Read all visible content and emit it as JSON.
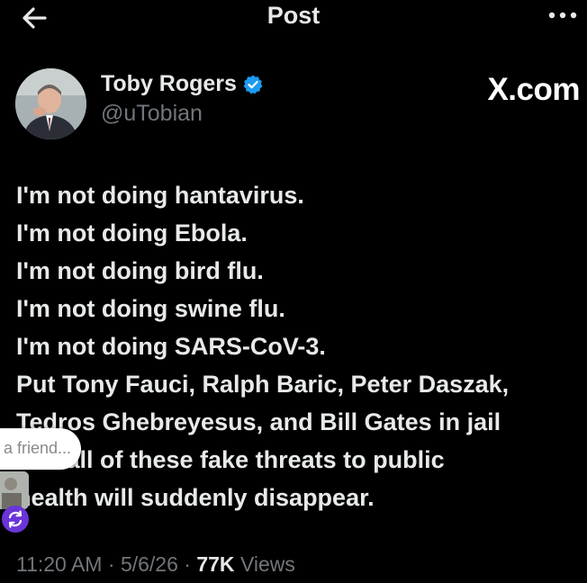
{
  "header": {
    "title": "Post",
    "back_icon": "arrow-left-icon",
    "more_icon": "more-horizontal-icon"
  },
  "author": {
    "name": "Toby Rogers",
    "handle": "@uTobian",
    "verified": true,
    "verified_color": "#1d9bf0"
  },
  "brand": "X.com",
  "post": {
    "lines": [
      "I'm not doing hantavirus.",
      "I'm not doing Ebola.",
      "I'm not doing bird flu.",
      "I'm not doing swine flu.",
      "I'm not doing SARS-CoV-3.",
      "Put Tony Fauci, Ralph Baric, Peter Daszak,",
      "Tedros Ghebreyesus, and Bill Gates in jail",
      "and all of these fake threats to public",
      "health will suddenly disappear."
    ]
  },
  "meta": {
    "time": "11:20 AM",
    "date": "5/6/26",
    "views_count": "77K",
    "views_label": "Views",
    "separator": "·"
  },
  "overlay": {
    "share_text": "a friend...",
    "loop_button_color": "#6a35d8"
  }
}
